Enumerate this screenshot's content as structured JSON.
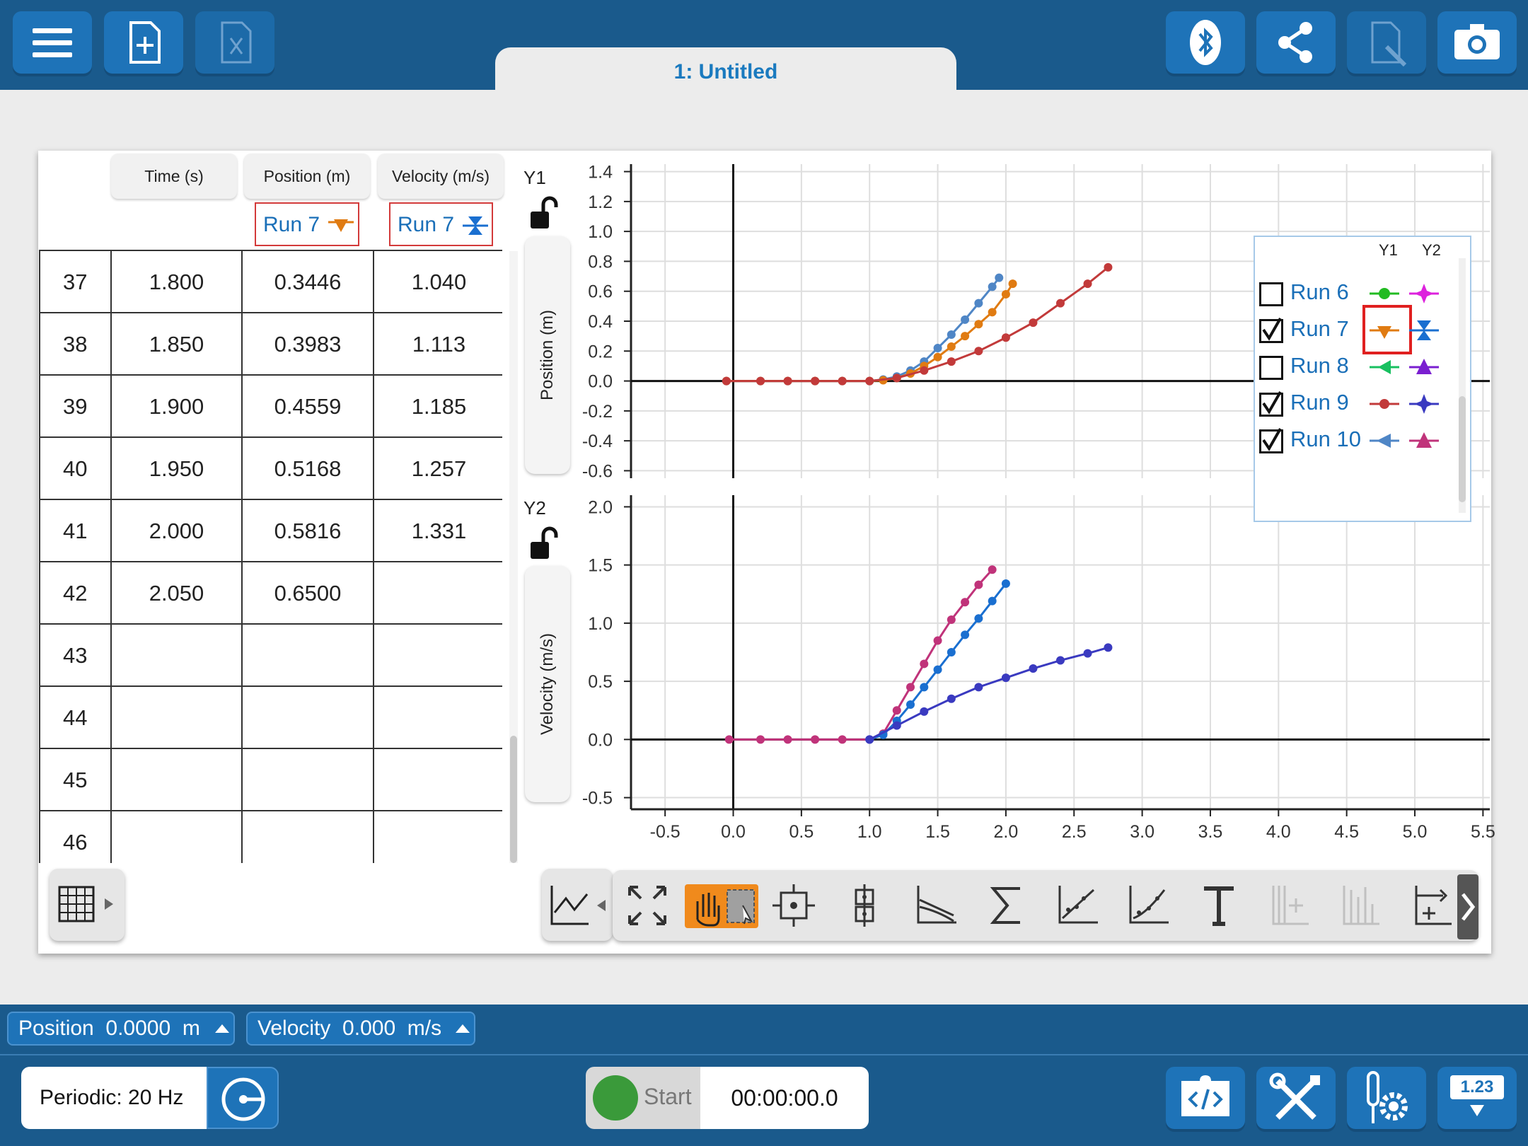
{
  "document_tab": "1: Untitled",
  "table": {
    "columns": [
      "Time (s)",
      "Position (m)",
      "Velocity (m/s)"
    ],
    "run_tags": [
      "Run 7",
      "Run 7"
    ],
    "rows": [
      {
        "index": "37",
        "time": "1.800",
        "position": "0.3446",
        "velocity": "1.040"
      },
      {
        "index": "38",
        "time": "1.850",
        "position": "0.3983",
        "velocity": "1.113"
      },
      {
        "index": "39",
        "time": "1.900",
        "position": "0.4559",
        "velocity": "1.185"
      },
      {
        "index": "40",
        "time": "1.950",
        "position": "0.5168",
        "velocity": "1.257"
      },
      {
        "index": "41",
        "time": "2.000",
        "position": "0.5816",
        "velocity": "1.331"
      },
      {
        "index": "42",
        "time": "2.050",
        "position": "0.6500",
        "velocity": ""
      },
      {
        "index": "43",
        "time": "",
        "position": "",
        "velocity": ""
      },
      {
        "index": "44",
        "time": "",
        "position": "",
        "velocity": ""
      },
      {
        "index": "45",
        "time": "",
        "position": "",
        "velocity": ""
      },
      {
        "index": "46",
        "time": "",
        "position": "",
        "velocity": ""
      }
    ]
  },
  "graph": {
    "y1_tag": "Y1",
    "y2_tag": "Y2",
    "y1_label": "Position (m)",
    "y2_label": "Velocity (m/s)"
  },
  "legend": {
    "col_y1": "Y1",
    "col_y2": "Y2",
    "runs": [
      {
        "name": "Run 6",
        "checked": false,
        "y1_color": "#22bb22",
        "y2_color": "#dd22dd"
      },
      {
        "name": "Run 7",
        "checked": true,
        "y1_color": "#e07b12",
        "y2_color": "#1a6fd0"
      },
      {
        "name": "Run 8",
        "checked": false,
        "y1_color": "#18c060",
        "y2_color": "#7a1fd0"
      },
      {
        "name": "Run 9",
        "checked": true,
        "y1_color": "#c23a3a",
        "y2_color": "#3a3ac0"
      },
      {
        "name": "Run 10",
        "checked": true,
        "y1_color": "#4f86c6",
        "y2_color": "#c0337a"
      }
    ]
  },
  "chart_data": [
    {
      "type": "scatter",
      "title": "",
      "xlabel": "",
      "ylabel": "Position (m)",
      "xlim": [
        -0.75,
        5.55
      ],
      "ylim": [
        -0.65,
        1.45
      ],
      "x_ticks": [
        "-0.5",
        "0.0",
        "0.5",
        "1.0",
        "1.5",
        "2.0",
        "2.5",
        "3.0",
        "3.5",
        "4.0",
        "4.5",
        "5.0",
        "5.5"
      ],
      "y_ticks": [
        "1.4",
        "1.2",
        "1.0",
        "0.8",
        "0.6",
        "0.4",
        "0.2",
        "0.0",
        "-0.2",
        "-0.4",
        "-0.6"
      ],
      "grid": true,
      "series": [
        {
          "name": "Run 10",
          "color": "#4f86c6",
          "x": [
            -0.05,
            0.2,
            0.4,
            0.6,
            0.8,
            1.0,
            1.1,
            1.2,
            1.3,
            1.4,
            1.5,
            1.6,
            1.7,
            1.8,
            1.9,
            1.95
          ],
          "y": [
            0,
            0,
            0,
            0,
            0,
            0,
            0.01,
            0.03,
            0.07,
            0.13,
            0.22,
            0.31,
            0.41,
            0.52,
            0.63,
            0.69
          ]
        },
        {
          "name": "Run 7",
          "color": "#e07b12",
          "x": [
            -0.05,
            0.2,
            0.4,
            0.6,
            0.8,
            1.0,
            1.1,
            1.2,
            1.3,
            1.4,
            1.5,
            1.6,
            1.7,
            1.8,
            1.9,
            2.0,
            2.05
          ],
          "y": [
            0,
            0,
            0,
            0,
            0,
            0,
            0.005,
            0.02,
            0.05,
            0.1,
            0.16,
            0.23,
            0.3,
            0.38,
            0.46,
            0.58,
            0.65
          ]
        },
        {
          "name": "Run 9",
          "color": "#c23a3a",
          "x": [
            -0.05,
            0.2,
            0.4,
            0.6,
            0.8,
            1.0,
            1.2,
            1.4,
            1.6,
            1.8,
            2.0,
            2.2,
            2.4,
            2.6,
            2.75
          ],
          "y": [
            0,
            0,
            0,
            0,
            0,
            0,
            0.02,
            0.07,
            0.13,
            0.2,
            0.29,
            0.39,
            0.52,
            0.65,
            0.76
          ]
        }
      ]
    },
    {
      "type": "scatter",
      "title": "",
      "xlabel": "",
      "ylabel": "Velocity (m/s)",
      "xlim": [
        -0.75,
        5.55
      ],
      "ylim": [
        -0.6,
        2.1
      ],
      "x_ticks": [
        "-0.5",
        "0.0",
        "0.5",
        "1.0",
        "1.5",
        "2.0",
        "2.5",
        "3.0",
        "3.5",
        "4.0",
        "4.5",
        "5.0",
        "5.5"
      ],
      "y_ticks": [
        "2.0",
        "1.5",
        "1.0",
        "0.5",
        "0.0",
        "-0.5"
      ],
      "grid": true,
      "series": [
        {
          "name": "Run 10",
          "color": "#c0337a",
          "x": [
            -0.03,
            0.2,
            0.4,
            0.6,
            0.8,
            1.0,
            1.1,
            1.2,
            1.3,
            1.4,
            1.5,
            1.6,
            1.7,
            1.8,
            1.9
          ],
          "y": [
            0,
            0,
            0,
            0,
            0,
            0,
            0.05,
            0.25,
            0.45,
            0.65,
            0.85,
            1.03,
            1.18,
            1.33,
            1.46
          ]
        },
        {
          "name": "Run 7",
          "color": "#1a6fd0",
          "x": [
            1.0,
            1.1,
            1.2,
            1.3,
            1.4,
            1.5,
            1.6,
            1.7,
            1.8,
            1.9,
            2.0
          ],
          "y": [
            0,
            0.04,
            0.16,
            0.3,
            0.45,
            0.6,
            0.75,
            0.9,
            1.04,
            1.19,
            1.34
          ]
        },
        {
          "name": "Run 9",
          "color": "#3a3ac0",
          "x": [
            1.0,
            1.2,
            1.4,
            1.6,
            1.8,
            2.0,
            2.2,
            2.4,
            2.6,
            2.75
          ],
          "y": [
            0,
            0.12,
            0.24,
            0.35,
            0.45,
            0.53,
            0.61,
            0.68,
            0.74,
            0.79
          ]
        }
      ]
    }
  ],
  "meters": {
    "position": "Position  0.0000  m",
    "velocity": "Velocity  0.000  m/s"
  },
  "collection": {
    "mode": "Periodic: 20 Hz",
    "start_label": "Start",
    "timer": "00:00:00.0"
  },
  "badge": {
    "meter_value": "1.23"
  },
  "colors": {
    "brand_blue": "#1a5a8c",
    "button_blue": "#1e73b8",
    "active_tool": "#f08a1c",
    "start_green": "#3a9a3a"
  }
}
